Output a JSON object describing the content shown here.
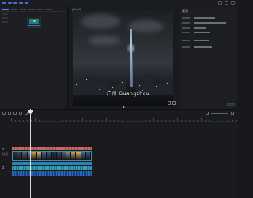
{
  "app": {
    "title": ""
  },
  "preview": {
    "panel_title": "播放器",
    "subtitle": "广州 Guangzhou"
  },
  "properties": {
    "panel_title": "视频",
    "rows": [
      {
        "key": "名称",
        "value": ""
      },
      {
        "key": "路径",
        "value": ""
      },
      {
        "key": "帧率",
        "value": ""
      },
      {
        "key": "分辨率",
        "value": ""
      }
    ]
  },
  "timeline": {
    "track_labels": [
      "",
      "",
      "",
      "",
      ""
    ],
    "video_track_label": "封面"
  },
  "colors": {
    "accent": "#3a6fd8",
    "clip_red": "#b7564e",
    "clip_video_border": "#3b8fa0",
    "clip_blue": "#2f7ec4",
    "clip_cyan": "#2d8c95",
    "clip_audio": "#1f4f92",
    "playhead": "#d8d8d8"
  },
  "icons": [
    "play-icon",
    "fullscreen-icon",
    "split-icon",
    "undo-icon",
    "zoom-icon"
  ]
}
